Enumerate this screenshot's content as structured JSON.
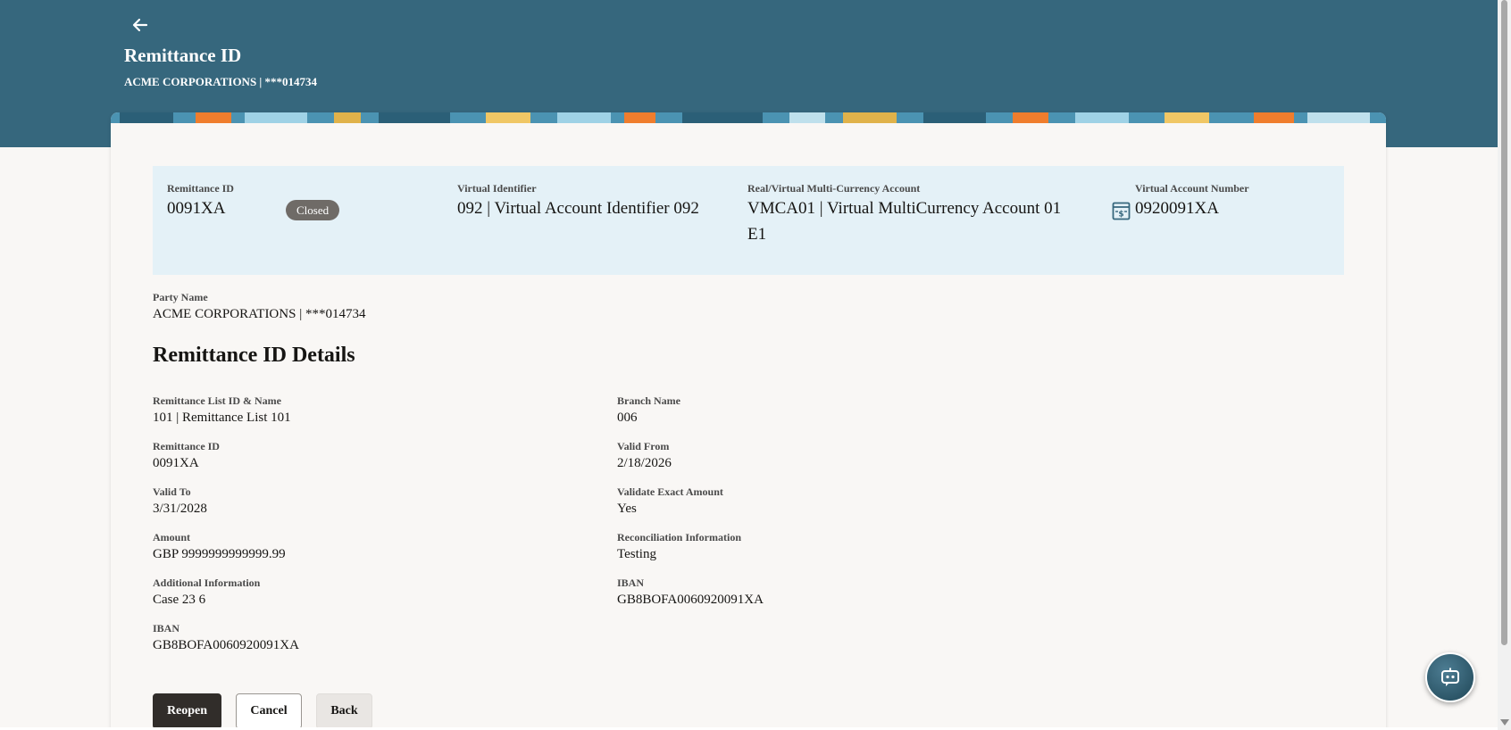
{
  "header": {
    "title": "Remittance ID",
    "subtitle": "ACME CORPORATIONS | ***014734"
  },
  "summary": {
    "remittance_id_label": "Remittance ID",
    "remittance_id_value": "0091XA",
    "status_badge": "Closed",
    "virtual_identifier_label": "Virtual Identifier",
    "virtual_identifier_value": "092 | Virtual Account Identifier 092",
    "mca_label": "Real/Virtual Multi-Currency Account",
    "mca_value_line1": "VMCA01 | Virtual MultiCurrency Account 01",
    "mca_value_line2": "E1",
    "van_label": "Virtual Account Number",
    "van_value": "0920091XA"
  },
  "party": {
    "label": "Party Name",
    "value": "ACME CORPORATIONS | ***014734"
  },
  "details": {
    "title": "Remittance ID Details",
    "left": [
      {
        "label": "Remittance List ID & Name",
        "value": "101 | Remittance List 101"
      },
      {
        "label": "Remittance ID",
        "value": "0091XA"
      },
      {
        "label": "Valid To",
        "value": "3/31/2028"
      },
      {
        "label": "Amount",
        "value": "GBP 9999999999999.99"
      },
      {
        "label": "Additional Information",
        "value": "Case 23 6"
      },
      {
        "label": "IBAN",
        "value": "GB8BOFA0060920091XA"
      }
    ],
    "right": [
      {
        "label": "Branch Name",
        "value": "006"
      },
      {
        "label": "Valid From",
        "value": "2/18/2026"
      },
      {
        "label": "Validate Exact Amount",
        "value": "Yes"
      },
      {
        "label": "Reconciliation Information",
        "value": "Testing"
      },
      {
        "label": "IBAN",
        "value": "GB8BOFA0060920091XA"
      }
    ]
  },
  "actions": {
    "reopen": "Reopen",
    "cancel": "Cancel",
    "back": "Back"
  },
  "icons": {
    "back": "arrow-left-icon",
    "virtual_account": "bank-card-icon",
    "assistant": "chatbot-icon"
  },
  "colors": {
    "header_bg": "#36677d",
    "summary_bg": "#e4f1f7",
    "primary_button": "#312d2a",
    "badge": "#6f6b67"
  }
}
